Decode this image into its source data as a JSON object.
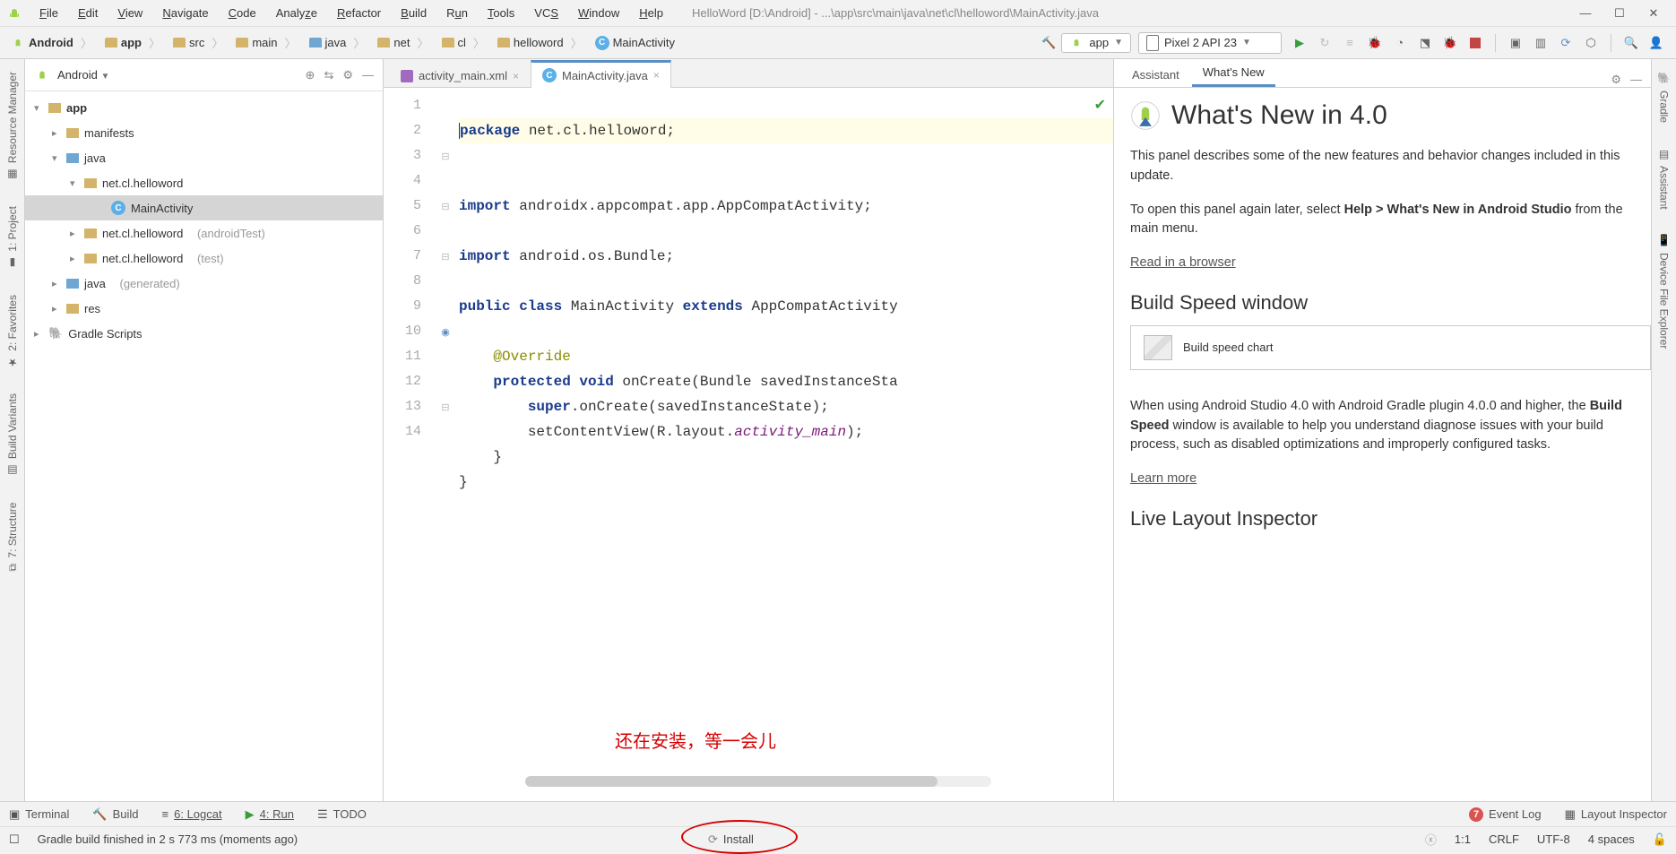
{
  "menu": {
    "items": [
      "File",
      "Edit",
      "View",
      "Navigate",
      "Code",
      "Analyze",
      "Refactor",
      "Build",
      "Run",
      "Tools",
      "VCS",
      "Window",
      "Help"
    ]
  },
  "title_path": "HelloWord [D:\\Android] - ...\\app\\src\\main\\java\\net\\cl\\helloword\\MainActivity.java",
  "breadcrumb": [
    "Android",
    "app",
    "src",
    "main",
    "java",
    "net",
    "cl",
    "helloword",
    "MainActivity"
  ],
  "run_config": "app",
  "device": "Pixel 2 API 23",
  "project_panel": {
    "title": "Android"
  },
  "tree": {
    "app": "app",
    "manifests": "manifests",
    "java": "java",
    "pkg1": "net.cl.helloword",
    "mainact": "MainActivity",
    "pkg2_a": "net.cl.helloword",
    "pkg2_b": "(androidTest)",
    "pkg3_a": "net.cl.helloword",
    "pkg3_b": "(test)",
    "gen_a": "java",
    "gen_b": "(generated)",
    "res": "res",
    "gradle": "Gradle Scripts"
  },
  "tabs": {
    "xml": "activity_main.xml",
    "java": "MainActivity.java"
  },
  "code": {
    "l1a": "package",
    "l1b": " net.cl.helloword;",
    "l3a": "import",
    "l3b": " androidx.appcompat.app.AppCompatActivity;",
    "l5a": "import",
    "l5b": " android.os.Bundle;",
    "l7a": "public ",
    "l7b": "class",
    "l7c": " MainActivity ",
    "l7d": "extends",
    "l7e": " AppCompatActivity",
    "l9": "    @Override",
    "l10a": "    ",
    "l10b": "protected ",
    "l10c": "void",
    "l10d": " onCreate(Bundle savedInstanceSta",
    "l11a": "        ",
    "l11b": "super",
    "l11c": ".onCreate(savedInstanceState);",
    "l12a": "        setContentView(R.layout.",
    "l12b": "activity_main",
    "l12c": ");",
    "l13": "    }",
    "l14": "}"
  },
  "line_numbers": [
    "1",
    "2",
    "3",
    "4",
    "5",
    "6",
    "7",
    "8",
    "9",
    "10",
    "11",
    "12",
    "13",
    "14"
  ],
  "overlay_cn": "还在安装，等一会儿",
  "right_tabs": {
    "assistant": "Assistant",
    "whatsnew": "What's New"
  },
  "whatsnew": {
    "heading": "What's New in 4.0",
    "p1": "This panel describes some of the new features and behavior changes included in this update.",
    "p2a": "To open this panel again later, select ",
    "p2b": "Help > What's New in Android Studio",
    "p2c": " from the main menu.",
    "link1": "Read in a browser",
    "h2": "Build Speed window",
    "chart": "Build speed chart",
    "p3a": "When using Android Studio 4.0 with Android Gradle plugin 4.0.0 and higher, the ",
    "p3b": "Build Speed",
    "p3c": " window is available to help you understand diagnose issues with your build process, such as disabled optimizations and improperly configured tasks.",
    "link2": "Learn more",
    "h3": "Live Layout Inspector"
  },
  "left_tools": {
    "res": "Resource Manager",
    "proj": "1: Project",
    "fav": "2: Favorites",
    "bv": "Build Variants",
    "struct": "7: Structure"
  },
  "right_tools": {
    "gradle": "Gradle",
    "assistant": "Assistant",
    "dev": "Device File Explorer"
  },
  "bottom_tools": {
    "terminal": "Terminal",
    "build": "Build",
    "logcat": "6: Logcat",
    "run": "4: Run",
    "todo": "TODO",
    "event": "Event Log",
    "layout": "Layout Inspector"
  },
  "status": {
    "msg": "Gradle build finished in 2 s 773 ms (moments ago)",
    "install": "Install",
    "pos": "1:1",
    "crlf": "CRLF",
    "enc": "UTF-8",
    "indent": "4 spaces"
  },
  "event_count": "7"
}
